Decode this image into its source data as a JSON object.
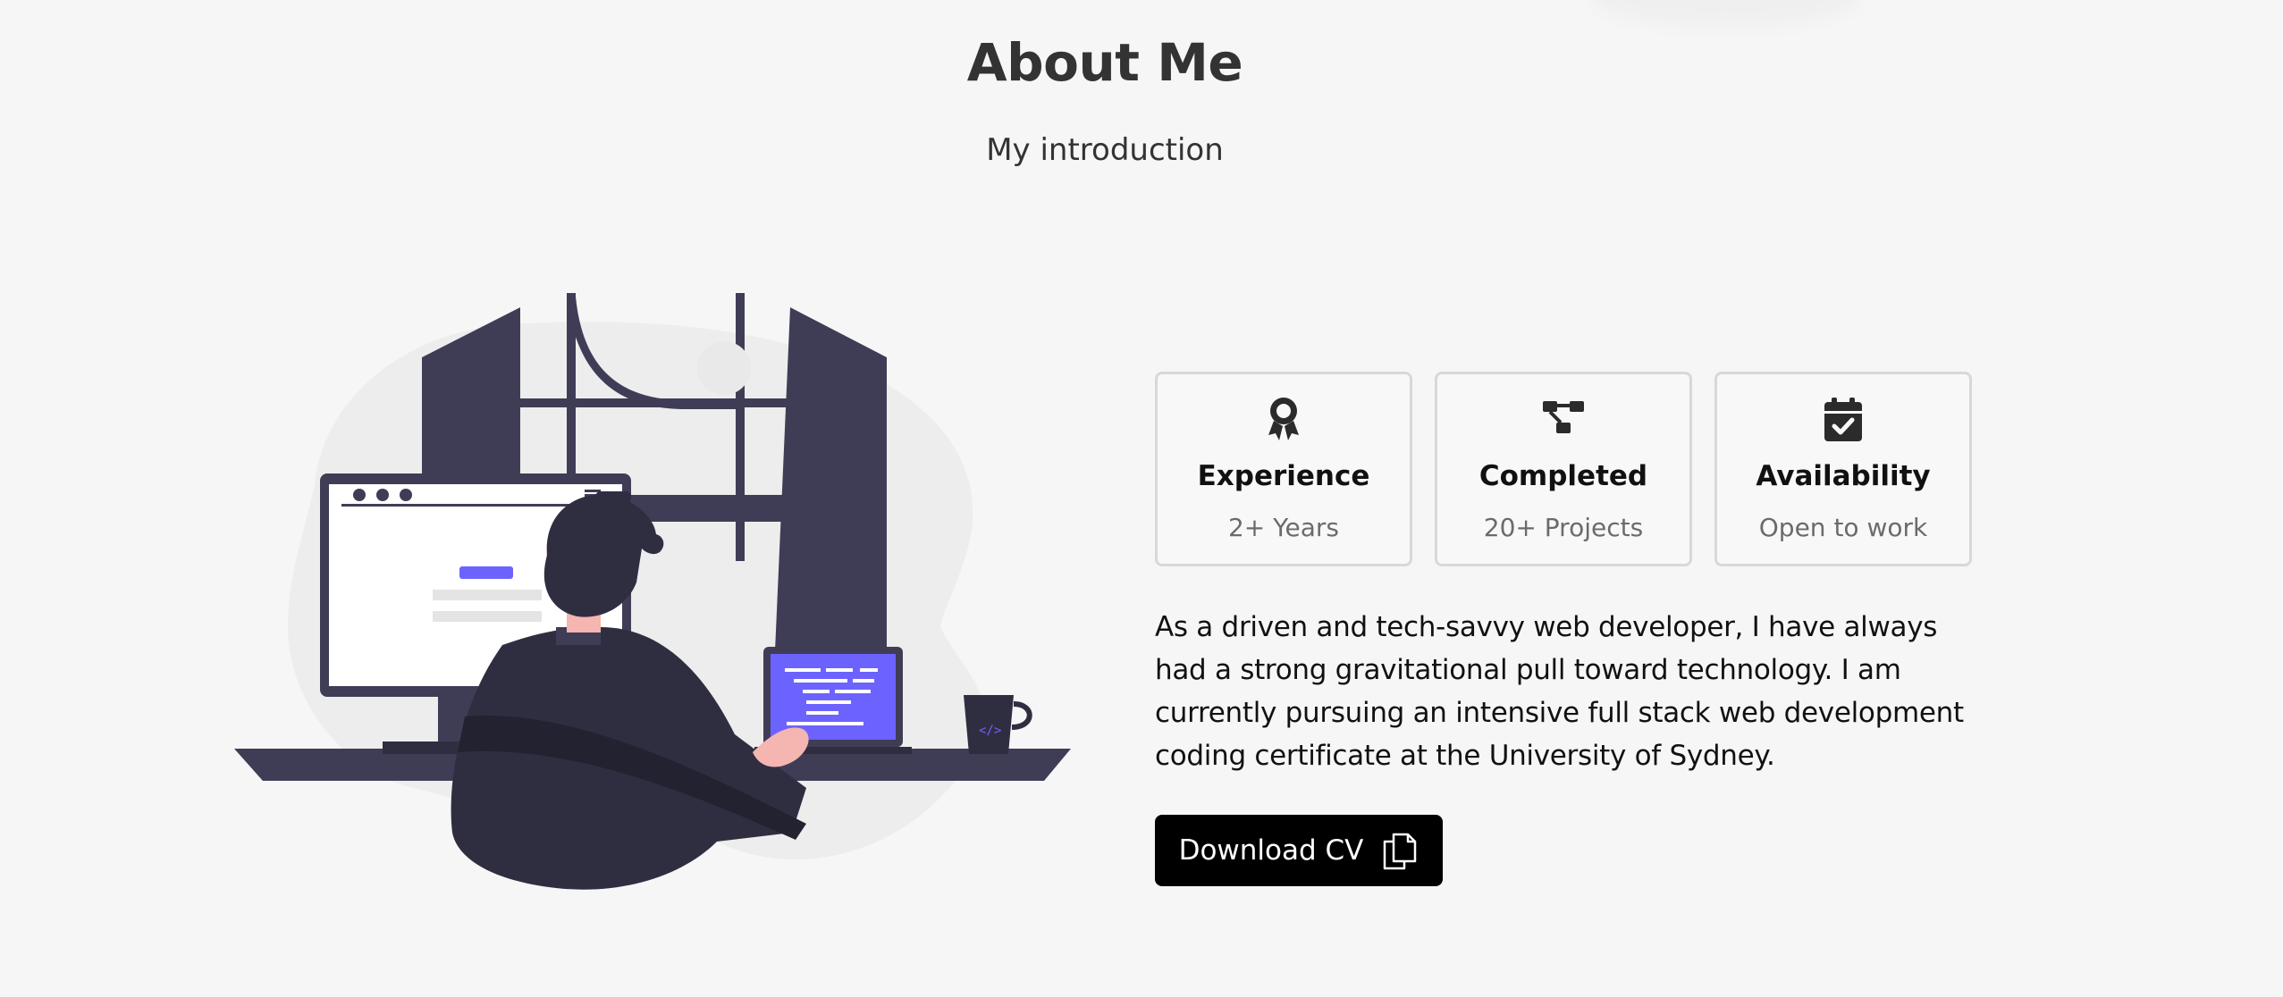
{
  "header": {
    "title": "About Me",
    "subtitle": "My introduction"
  },
  "illustration": {
    "icon": "developer-at-desk-illustration",
    "accent_color": "#6c63ff",
    "dark_color": "#3f3d56"
  },
  "cards": [
    {
      "icon": "award-icon",
      "title": "Experience",
      "value": "2+ Years"
    },
    {
      "icon": "project-diagram-icon",
      "title": "Completed",
      "value": "20+ Projects"
    },
    {
      "icon": "calendar-check-icon",
      "title": "Availability",
      "value": "Open to work"
    }
  ],
  "description": "As a driven and tech-savvy web developer, I have always had a strong gravitational pull toward technology. I am currently pursuing an intensive full stack web development coding certificate at the University of Sydney.",
  "cv_button": {
    "label": "Download CV",
    "icon": "document-copy-icon"
  }
}
